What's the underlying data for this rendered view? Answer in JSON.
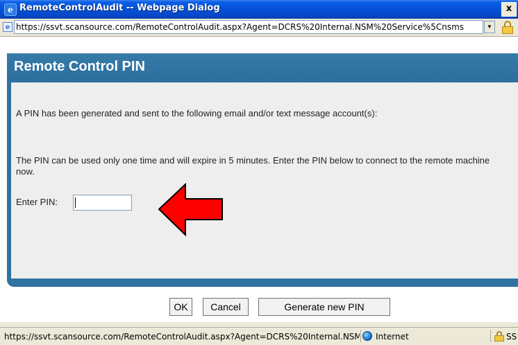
{
  "window": {
    "title": "RemoteControlAudit -- Webpage Dialog",
    "close_label": "x"
  },
  "address_bar": {
    "url": "https://ssvt.scansource.com/RemoteControlAudit.aspx?Agent=DCRS%20Internal.NSM%20Service%5Cnsms"
  },
  "panel": {
    "title": "Remote Control PIN",
    "message_sent": "A PIN has been generated and sent to the following email and/or text message account(s):",
    "message_instructions": "The PIN can be used only one time and will expire in 5 minutes. Enter the PIN below to connect to the remote machine now.",
    "pin_label": "Enter PIN:",
    "pin_value": "",
    "buttons": {
      "ok": "OK",
      "cancel": "Cancel",
      "generate": "Generate new PIN"
    }
  },
  "annotation": {
    "arrow_color": "#ff0000",
    "arrow_direction": "left"
  },
  "status_bar": {
    "url": "https://ssvt.scansource.com/RemoteControlAudit.aspx?Agent=DCRS%20Internal.NSM",
    "zone": "Internet",
    "security": "SS"
  },
  "colors": {
    "panel_blue": "#2f73a0",
    "titlebar_blue": "#0451d8",
    "panel_body": "#eeeeee"
  }
}
